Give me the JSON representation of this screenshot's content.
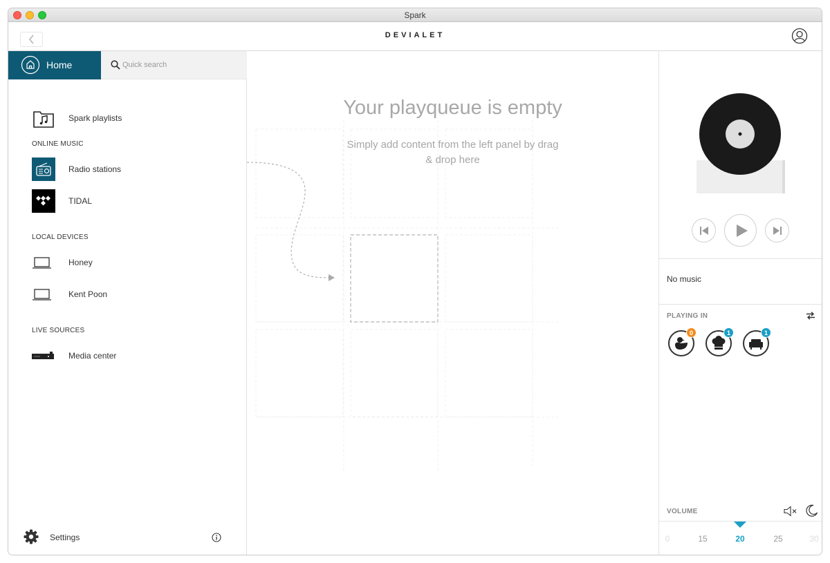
{
  "window": {
    "title": "Spark"
  },
  "header": {
    "brand": "DEVIALET"
  },
  "sidebar": {
    "home_label": "Home",
    "search_placeholder": "Quick search",
    "playlists_label": "Spark playlists",
    "online_music": {
      "heading": "ONLINE MUSIC",
      "items": [
        {
          "label": "Radio stations",
          "icon": "radio-icon"
        },
        {
          "label": "TIDAL",
          "icon": "tidal-icon"
        }
      ]
    },
    "local_devices": {
      "heading": "LOCAL DEVICES",
      "items": [
        {
          "label": "Honey",
          "icon": "laptop-icon"
        },
        {
          "label": "Kent Poon",
          "icon": "laptop-icon"
        }
      ]
    },
    "live_sources": {
      "heading": "LIVE SOURCES",
      "items": [
        {
          "label": "Media center",
          "icon": "media-center-icon"
        }
      ]
    },
    "settings_label": "Settings"
  },
  "main": {
    "empty_title": "Your playqueue is empty",
    "empty_subtitle": "Simply add content from the left panel by drag & drop here"
  },
  "player": {
    "now_playing": "No music",
    "playing_in_label": "PLAYING IN",
    "speakers": [
      {
        "icon": "duck-icon",
        "badge": "0",
        "badge_color": "#f28c1e"
      },
      {
        "icon": "chef-hat-icon",
        "badge": "1",
        "badge_color": "#1a9fc6"
      },
      {
        "icon": "sofa-icon",
        "badge": "1",
        "badge_color": "#1a9fc6"
      }
    ],
    "volume_label": "VOLUME",
    "volume_scale": [
      "0",
      "15",
      "20",
      "25",
      "30"
    ],
    "volume_current": "20"
  },
  "colors": {
    "accent": "#0e5a74",
    "volume_accent": "#1a9fc6"
  }
}
